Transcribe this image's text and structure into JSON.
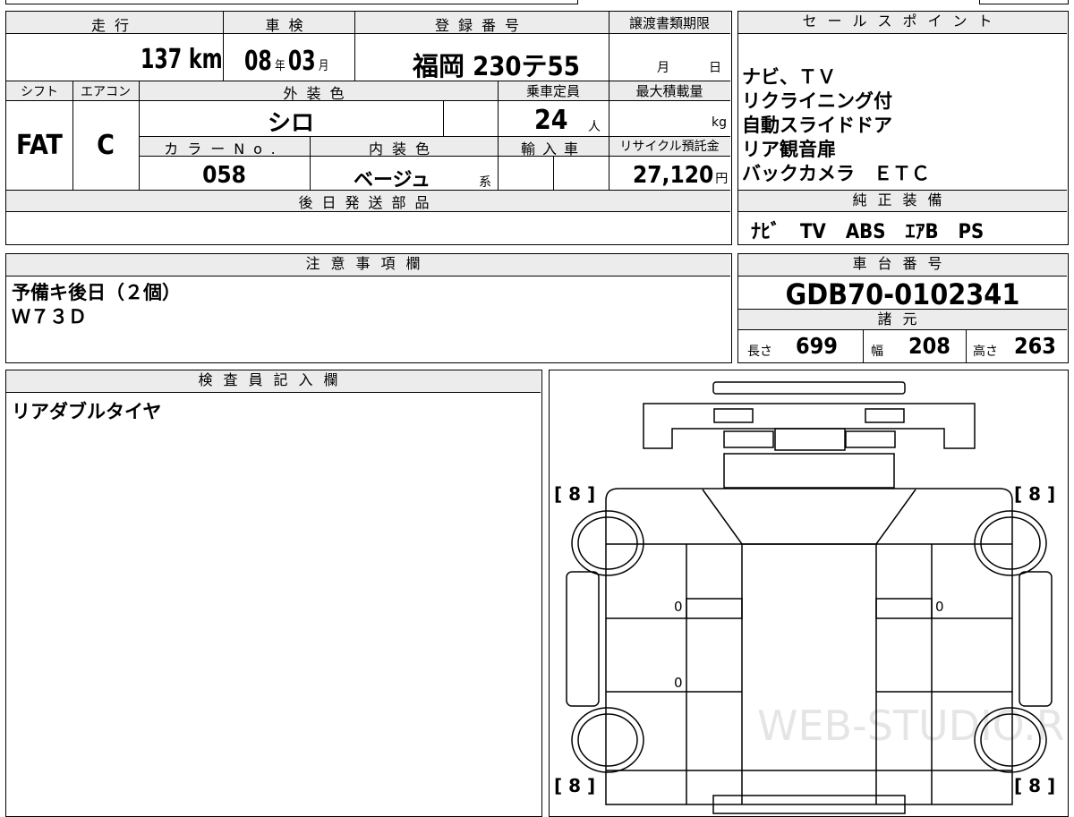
{
  "main_table": {
    "mileage_label": "走行",
    "mileage_value": "137",
    "mileage_unit": "km",
    "inspection_label": "車検",
    "inspection_year": "08",
    "inspection_year_unit": "年",
    "inspection_month": "03",
    "inspection_month_unit": "月",
    "registration_label": "登録番号",
    "registration_value": "福岡 230テ55",
    "transfer_label": "譲渡書類期限",
    "transfer_month_unit": "月",
    "transfer_day_unit": "日",
    "shift_label": "シフト",
    "shift_value": "FAT",
    "aircon_label": "エアコン",
    "aircon_value": "C",
    "exterior_color_label": "外装色",
    "exterior_color_value": "シロ",
    "capacity_label": "乗車定員",
    "capacity_value": "24",
    "capacity_unit": "人",
    "max_load_label": "最大積載量",
    "max_load_unit": "kg",
    "color_no_label": "カラーNo.",
    "color_no_value": "058",
    "interior_color_label": "内装色",
    "interior_color_value": "ベージュ",
    "interior_color_suffix": "系",
    "import_label": "輸入車",
    "recycle_label": "リサイクル預託金",
    "recycle_value": "27,120",
    "recycle_unit": "円",
    "later_parts_label": "後日発送部品"
  },
  "sales_points": {
    "header": "セールスポイント",
    "lines": [
      "ナビ、ＴＶ",
      "リクライニング付",
      "自動スライドドア",
      "リア観音扉",
      "バックカメラ　ＥＴＣ"
    ]
  },
  "genuine_equipment": {
    "header": "純正装備",
    "value": "ﾅﾋﾞ　TV　ABS　ｴｱB　PS"
  },
  "notes": {
    "header": "注意事項欄",
    "lines": [
      "予備キ後日（２個）",
      "Ｗ７３Ｄ"
    ]
  },
  "chassis": {
    "header": "車台番号",
    "value": "GDB70-0102341"
  },
  "specs": {
    "header": "諸元",
    "length_label": "長さ",
    "length_value": "699",
    "width_label": "幅",
    "width_value": "208",
    "height_label": "高さ",
    "height_value": "263"
  },
  "inspector": {
    "header": "検査員記入欄",
    "text": "リアダブルタイヤ"
  },
  "diagram": {
    "tire_front_left": "[ 8 ]",
    "tire_front_right": "[ 8 ]",
    "tire_rear_left": "[ 8 ]",
    "tire_rear_right": "[ 8 ]",
    "mark_1": "0",
    "mark_2": "0",
    "mark_3": "0"
  },
  "watermark": "WEB-STUDIO.RU"
}
